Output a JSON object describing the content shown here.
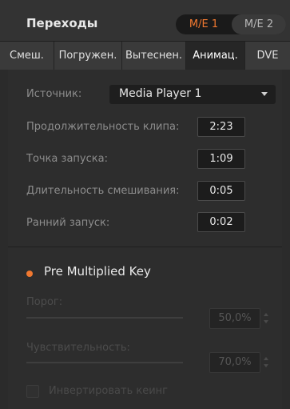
{
  "header": {
    "title": "Переходы",
    "me_buttons": [
      "M/E 1",
      "M/E 2"
    ],
    "active_me": "M/E 1"
  },
  "tabs": [
    {
      "label": "Смеш."
    },
    {
      "label": "Погружен."
    },
    {
      "label": "Вытеснен."
    },
    {
      "label": "Анимац.",
      "active": true
    },
    {
      "label": "DVE"
    }
  ],
  "settings": {
    "source_label": "Источник:",
    "source_value": "Media Player 1",
    "clip_duration_label": "Продолжительность клипа:",
    "clip_duration_value": "2:23",
    "trigger_point_label": "Точка запуска:",
    "trigger_point_value": "1:09",
    "mix_duration_label": "Длительность смешивания:",
    "mix_duration_value": "0:05",
    "pre_roll_label": "Ранний запуск:",
    "pre_roll_value": "0:02"
  },
  "key": {
    "pre_multiplied_label": "Pre Multiplied Key",
    "pre_multiplied_enabled": true,
    "clip_label": "Порог:",
    "clip_value": "50,0%",
    "gain_label": "Чувствительность:",
    "gain_value": "70,0%",
    "invert_label": "Инвертировать кеинг",
    "invert_checked": false
  },
  "colors": {
    "accent": "#f07830",
    "background": "#2b2b2b"
  }
}
